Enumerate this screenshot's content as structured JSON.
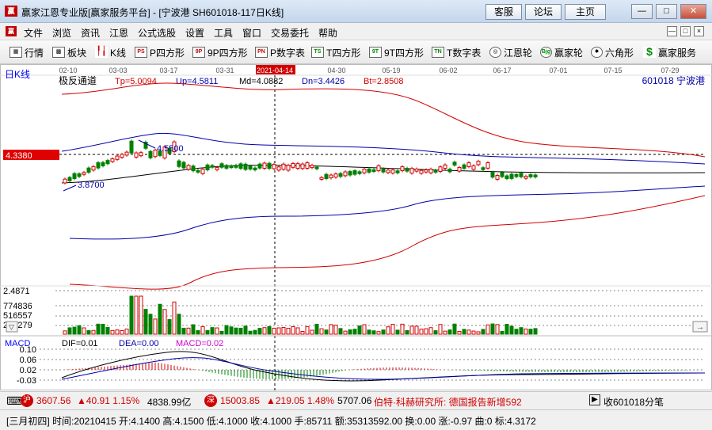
{
  "window": {
    "title": "赢家江恩专业版[赢家服务平台] - [宁波港  SH601018-117日K线]",
    "logo_text": "赢",
    "buttons": [
      "客服",
      "论坛",
      "主页"
    ],
    "controls": [
      "—",
      "□",
      "✕"
    ]
  },
  "menu": {
    "logo_text": "赢",
    "items": [
      "文件",
      "浏览",
      "资讯",
      "江恩",
      "公式选股",
      "设置",
      "工具",
      "窗口",
      "交易委托",
      "帮助"
    ],
    "mdi_controls": [
      "—",
      "□",
      "×"
    ]
  },
  "toolbar": {
    "items": [
      {
        "label": "行情",
        "icon": "table-icon"
      },
      {
        "label": "板块",
        "icon": "grid-icon"
      },
      {
        "label": "K线",
        "icon": "candle-icon"
      },
      {
        "label": "P四方形",
        "icon": "PS"
      },
      {
        "label": "9P四方形",
        "icon": "9P"
      },
      {
        "label": "P数字表",
        "icon": "PN"
      },
      {
        "label": "T四方形",
        "icon": "TS"
      },
      {
        "label": "9T四方形",
        "icon": "9T"
      },
      {
        "label": "T数字表",
        "icon": "TN"
      },
      {
        "label": "江恩轮",
        "icon": "wheel-icon"
      },
      {
        "label": "赢家轮",
        "icon": "Bjg"
      },
      {
        "label": "六角形",
        "icon": "hexagon-icon"
      },
      {
        "label": "赢家服务",
        "icon": "dollar-icon"
      }
    ]
  },
  "chart": {
    "period_label": "日K线",
    "date_ticks": [
      "02-10",
      "03-03",
      "03-17",
      "03-31",
      "2021-04-14",
      "04-30",
      "05-19",
      "06-02",
      "06-17",
      "07-01",
      "07-15",
      "07-29"
    ],
    "indicator": {
      "name": "极反通道",
      "tp": "Tp=5.0094",
      "up": "Up=4.5811",
      "md": "Md=4.0882",
      "dn": "Dn=3.4426",
      "bt": "Bt=2.8508"
    },
    "stock": "601018  宁波港",
    "price_marker": "4.3380",
    "high_label": "4.5500",
    "low_label": "3.8700",
    "vol_axis": [
      "2.4871",
      "774836",
      "516557",
      "258279"
    ],
    "macd": {
      "name": "MACD",
      "dif": "DIF=0.01",
      "dea": "DEA=0.00",
      "macd": "MACD=0.02",
      "axis": [
        "0.10",
        "0.06",
        "0.02",
        "-0.03"
      ]
    }
  },
  "status1": {
    "sh_icon": "沪",
    "sh_index": "3607.56",
    "sh_change": "▲40.91 1.15%",
    "sh_amount": "4838.99亿",
    "sz_icon": "深",
    "sz_index": "15003.85",
    "sz_change": "▲219.05 1.48%",
    "sz_amount": "5707.06",
    "news": "伯特·科赫研究所: 德国报告新增592",
    "record": "收601018分笔"
  },
  "status2": {
    "text": "[三月初四] 时间:20210415 开:4.1400 高:4.1500 低:4.1000 收:4.1000 手:85711 额:35313592.00 换:0.00 涨:-0.97 曲:0 标:4.3172"
  },
  "colors": {
    "red": "#d10000",
    "blue": "#0000aa",
    "green": "#008000",
    "magenta": "#cc00cc"
  }
}
